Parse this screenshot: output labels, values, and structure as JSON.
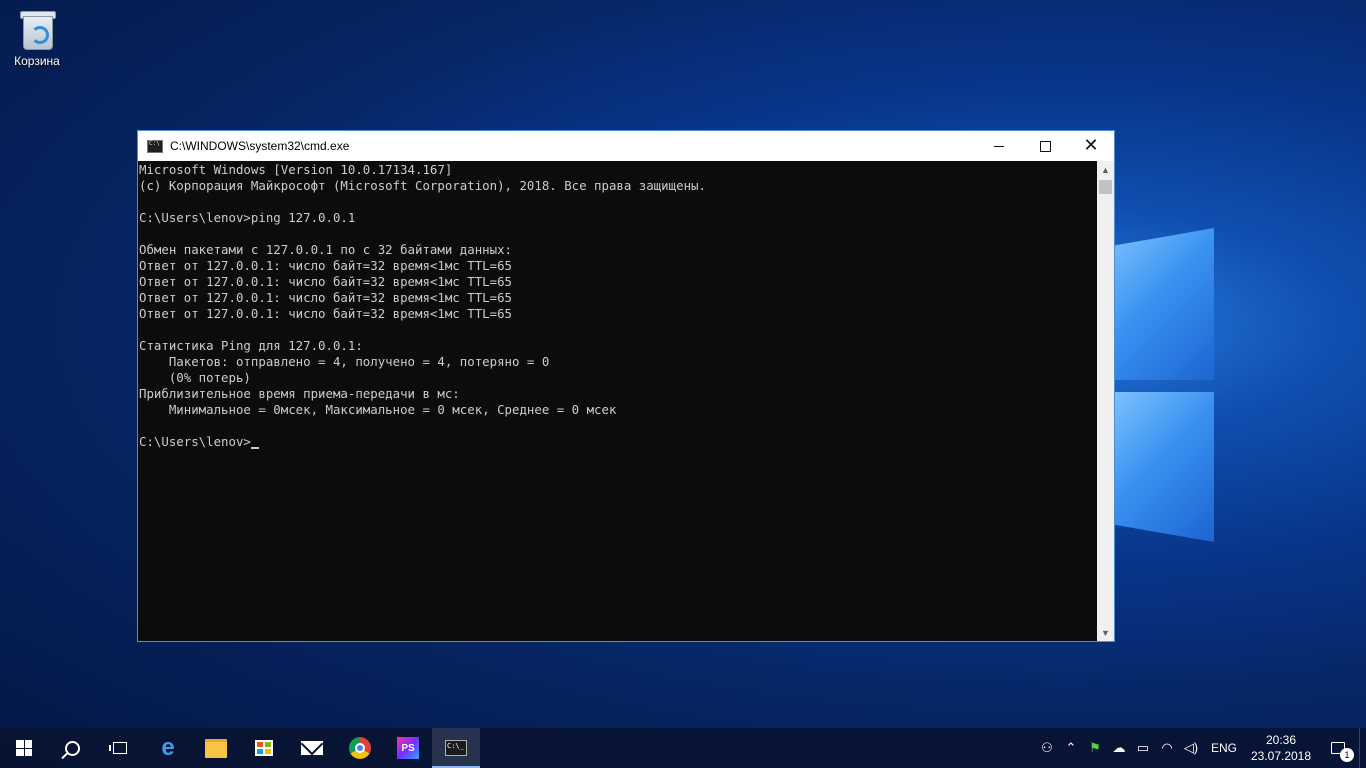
{
  "desktop": {
    "recycle_bin_label": "Корзина"
  },
  "window": {
    "title": "C:\\WINDOWS\\system32\\cmd.exe",
    "console_lines": [
      "Microsoft Windows [Version 10.0.17134.167]",
      "(c) Корпорация Майкрософт (Microsoft Corporation), 2018. Все права защищены.",
      "",
      "C:\\Users\\lenov>ping 127.0.0.1",
      "",
      "Обмен пакетами с 127.0.0.1 по с 32 байтами данных:",
      "Ответ от 127.0.0.1: число байт=32 время<1мс TTL=65",
      "Ответ от 127.0.0.1: число байт=32 время<1мс TTL=65",
      "Ответ от 127.0.0.1: число байт=32 время<1мс TTL=65",
      "Ответ от 127.0.0.1: число байт=32 время<1мс TTL=65",
      "",
      "Статистика Ping для 127.0.0.1:",
      "    Пакетов: отправлено = 4, получено = 4, потеряно = 0",
      "    (0% потерь)",
      "Приблизительное время приема-передачи в мс:",
      "    Минимальное = 0мсек, Максимальное = 0 мсек, Среднее = 0 мсек",
      ""
    ],
    "prompt": "C:\\Users\\lenov>"
  },
  "taskbar": {
    "ps_label": "PS",
    "cmd_label": "C:\\_",
    "language": "ENG",
    "time": "20:36",
    "date": "23.07.2018",
    "notification_count": "1"
  }
}
